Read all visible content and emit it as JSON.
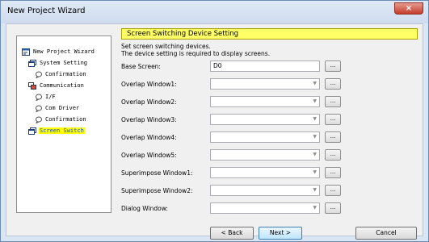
{
  "window": {
    "title": "New Project Wizard",
    "close_glyph": "×"
  },
  "tree": {
    "items": [
      {
        "label": "New Project Wizard",
        "icon": "wizard-icon"
      },
      {
        "label": "System Setting",
        "icon": "window-icon"
      },
      {
        "label": "Confirmation",
        "icon": "bubble-icon"
      },
      {
        "label": "Communication",
        "icon": "network-icon"
      },
      {
        "label": "I/F",
        "icon": "bubble-icon"
      },
      {
        "label": "Com Driver",
        "icon": "bubble-icon"
      },
      {
        "label": "Confirmation",
        "icon": "bubble-icon"
      },
      {
        "label": "Screen Switch",
        "icon": "window-icon",
        "selected": true
      }
    ]
  },
  "main": {
    "heading": "Screen Switching Device Setting",
    "description": [
      "Set screen switching devices.",
      "The device setting is required to display screens."
    ],
    "rows": [
      {
        "label": "Base Screen:",
        "value": "D0",
        "button": "..."
      },
      {
        "label": "Overlap Window1:",
        "value": "",
        "button": "..."
      },
      {
        "label": "Overlap Window2:",
        "value": "",
        "button": "..."
      },
      {
        "label": "Overlap Window3:",
        "value": "",
        "button": "..."
      },
      {
        "label": "Overlap Window4:",
        "value": "",
        "button": "..."
      },
      {
        "label": "Overlap Window5:",
        "value": "",
        "button": "..."
      },
      {
        "label": "Superimpose Window1:",
        "value": "",
        "button": "..."
      },
      {
        "label": "Superimpose Window2:",
        "value": "",
        "button": "..."
      },
      {
        "label": "Dialog Window:",
        "value": "",
        "button": "..."
      }
    ]
  },
  "footer": {
    "back": "< Back",
    "next": "Next >",
    "cancel": "Cancel"
  },
  "colors": {
    "highlight": "#ffff66",
    "selection": "#ffff00"
  }
}
